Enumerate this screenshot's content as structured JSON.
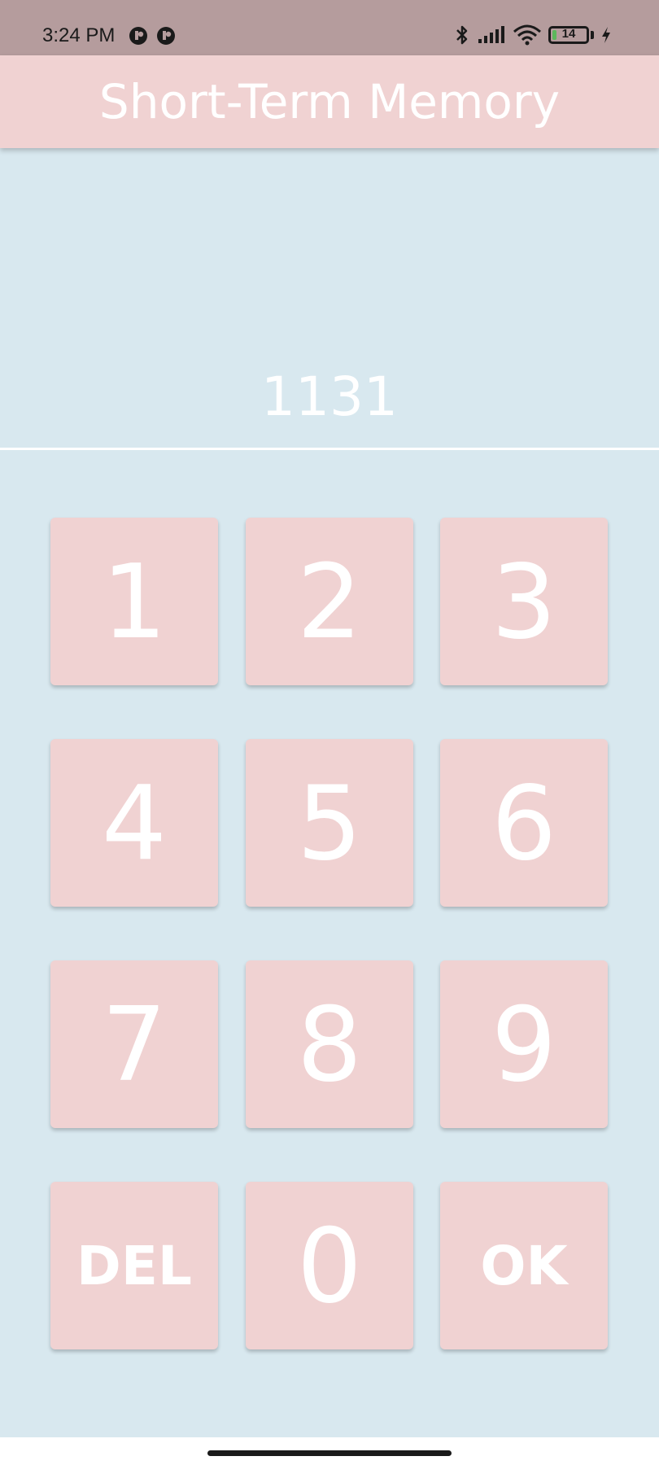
{
  "status_bar": {
    "time": "3:24 PM",
    "battery_level": "14",
    "battery_fraction": 0.14,
    "icons": [
      "app-notification-icon",
      "app-notification-icon",
      "bluetooth-icon",
      "signal-icon",
      "wifi-icon",
      "battery-icon",
      "charging-icon"
    ]
  },
  "app_bar": {
    "title": "Short-Term Memory"
  },
  "display": {
    "value": "1131"
  },
  "keypad": {
    "keys": [
      "1",
      "2",
      "3",
      "4",
      "5",
      "6",
      "7",
      "8",
      "9",
      "DEL",
      "0",
      "OK"
    ]
  },
  "colors": {
    "background": "#d8e8ef",
    "accent": "#f0d2d2",
    "status_bar": "#b59c9d",
    "text": "#ffffff"
  }
}
